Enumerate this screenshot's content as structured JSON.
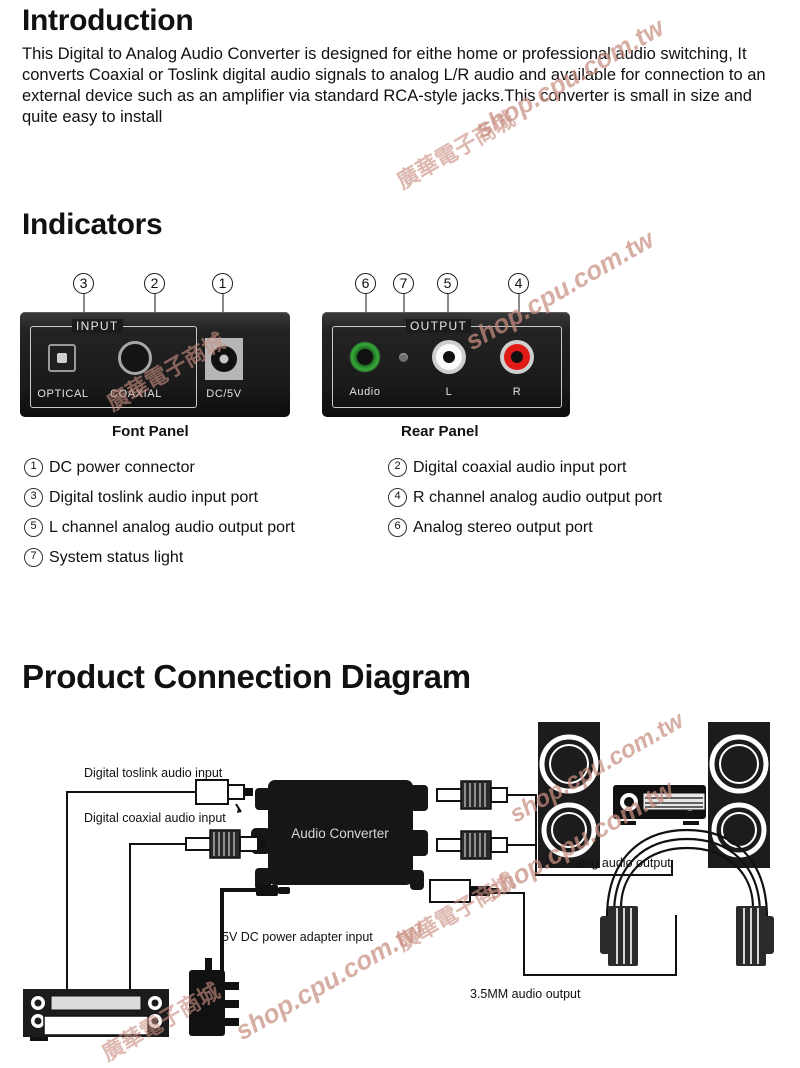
{
  "sections": {
    "intro": {
      "heading": "Introduction",
      "paragraph": "This Digital to Analog Audio Converter is designed for eithe home or professional audio switching, It converts Coaxial or Toslink digital audio signals to analog L/R audio and available for connection to an external device such as an amplifier via standard RCA-style jacks.This converter is small in size and quite easy to install"
    },
    "indicators": {
      "heading": "Indicators",
      "front_panel": {
        "caption": "Font Panel",
        "group_label": "INPUT",
        "ports": [
          {
            "label": "OPTICAL",
            "number": "3"
          },
          {
            "label": "COAXIAL",
            "number": "2"
          },
          {
            "label": "DC/5V",
            "number": "1"
          }
        ]
      },
      "rear_panel": {
        "caption": "Rear Panel",
        "group_label": "OUTPUT",
        "ports": [
          {
            "label": "Audio",
            "number": "6"
          },
          {
            "label": "",
            "number": "7"
          },
          {
            "label": "L",
            "number": "5"
          },
          {
            "label": "R",
            "number": "4"
          }
        ]
      },
      "legend": [
        {
          "num": "1",
          "text": "DC power  connector"
        },
        {
          "num": "2",
          "text": "Digital coaxial audio input port"
        },
        {
          "num": "3",
          "text": "Digital toslink audio input port"
        },
        {
          "num": "4",
          "text": "R channel analog audio output port"
        },
        {
          "num": "5",
          "text": "L channel analog audio output port"
        },
        {
          "num": "6",
          "text": "Analog stereo output port"
        },
        {
          "num": "7",
          "text": "System status light"
        }
      ]
    },
    "diagram": {
      "heading": "Product Connection Diagram",
      "device_label": "Audio Converter",
      "labels": {
        "toslink_input": "Digital toslink audio input",
        "coaxial_input": "Digital coaxial audio input",
        "power_input": "5V DC power adapter input",
        "lr_output": "L/R analog audio output",
        "jack_output": "3.5MM audio output"
      }
    }
  },
  "watermark": {
    "latin": "shop.cpu.com.tw",
    "chinese": "廣華電子商城",
    "color": "#c98f82"
  },
  "colors": {
    "panel_body": "#1a1a1a",
    "rca_red": "#e01b16",
    "rca_white": "#fbfbfb",
    "audio_green": "#38a83a",
    "text": "#111111"
  }
}
